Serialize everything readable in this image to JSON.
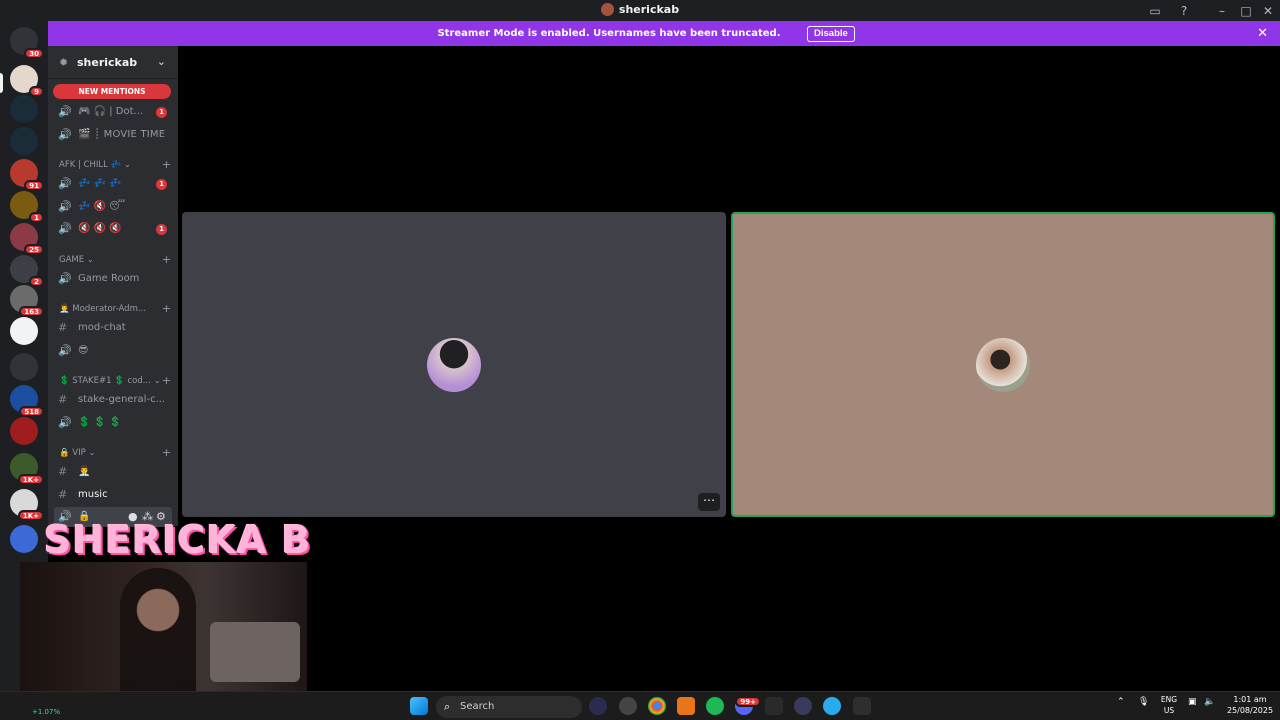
{
  "window": {
    "title": "sherickab"
  },
  "banner": {
    "message": "Streamer Mode is enabled. Usernames have been truncated.",
    "action": "Disable"
  },
  "guild_badges": [
    "30",
    "9",
    "91",
    "1",
    "25",
    "2",
    "163",
    "518",
    "1K+",
    "1K+"
  ],
  "server": {
    "name": "sherickab"
  },
  "new_mentions": "NEW MENTIONS",
  "channels": {
    "voice1": {
      "label": "🎮 🎧 | Dot...",
      "badge": "1"
    },
    "voice2": {
      "label": "🎬 ┊ MOVIE TIME"
    },
    "cat_afk": "AFK | CHILL 💤 ⌄",
    "afk1": {
      "label": "💤 💤 💤",
      "badge": "1"
    },
    "afk2": {
      "label": "💤 🔇 😴"
    },
    "afk3": {
      "label": "🔇 🔇 🔇",
      "badge": "1"
    },
    "cat_game": "GAME ⌄",
    "game_room": {
      "label": "Game Room"
    },
    "cat_mod": "👨‍💼 Moderator-Adm...",
    "mod_chat": {
      "label": "mod-chat"
    },
    "mod_voice": {
      "label": "😎"
    },
    "cat_stake": "💲 STAKE#1 💲 cod... ⌄",
    "stake_general": {
      "label": "stake-general-c..."
    },
    "stake_voice": {
      "label": "💲 💲 💲"
    },
    "cat_vip": "🔒 VIP ⌄",
    "vip_text": {
      "label": "👨‍💼"
    },
    "music": {
      "label": "music"
    },
    "locked_voice": {
      "label": "🔒"
    }
  },
  "stream_overlay": {
    "name": "SHERICKA B"
  },
  "taskbar": {
    "search": "Search",
    "lang_line1": "ENG",
    "lang_line2": "US",
    "time": "1:01 am",
    "date": "25/08/2025",
    "ticker": "+1.07%",
    "discord_badge": "99+"
  },
  "colors": {
    "blurple_banner": "#9036e8",
    "mention_red": "#da373c",
    "speaking_green": "#23a559"
  }
}
